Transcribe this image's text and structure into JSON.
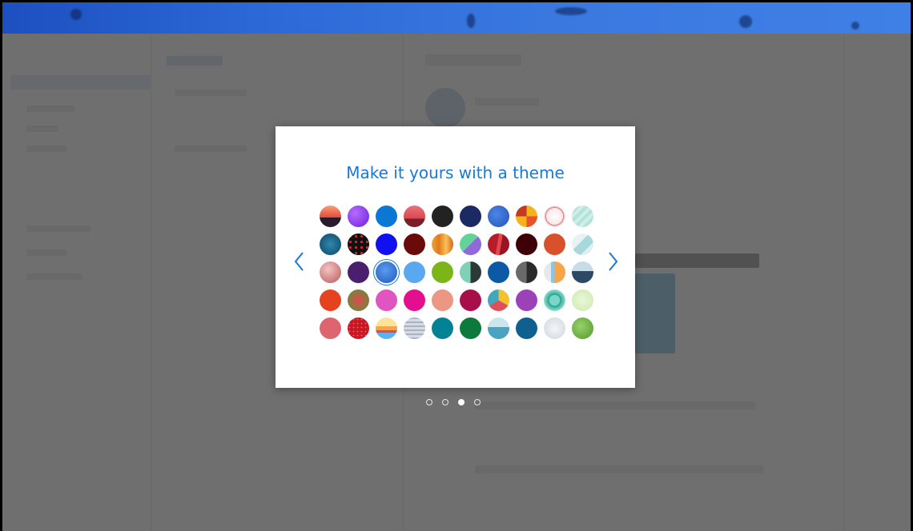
{
  "dialog": {
    "title": "Make it yours with a theme",
    "prev_icon": "chevron-left-icon",
    "next_icon": "chevron-right-icon"
  },
  "pager": {
    "count": 4,
    "active_index": 2
  },
  "colors": {
    "accent": "#1a78d6",
    "overlay": "rgba(80,80,80,0.82)",
    "header_band": "#2d6ad8"
  },
  "themes": [
    [
      {
        "name": "sunset",
        "bg": "linear-gradient(180deg,#f6a07a 0%,#e44b3a 55%,#2b1a2e 56%,#2b1a2e 100%)"
      },
      {
        "name": "purple-swirl",
        "bg": "radial-gradient(circle at 35% 35%,#b66cff,#6b1fe0)"
      },
      {
        "name": "blue",
        "bg": "#0a78d4"
      },
      {
        "name": "red-mountains",
        "bg": "linear-gradient(180deg,#e8737a 0%,#d9484f 60%,#7a1e2c 61%,#7a1e2c 100%)"
      },
      {
        "name": "charcoal",
        "bg": "#222222"
      },
      {
        "name": "navy",
        "bg": "#1c2a63"
      },
      {
        "name": "blue-texture",
        "bg": "radial-gradient(circle at 40% 40%,#4d86e6,#1f55b8)"
      },
      {
        "name": "orange-geo",
        "bg": "conic-gradient(#f5b21b 0 25%,#e8532a 0 50%,#f5b21b 0 75%,#c23a20 0)"
      },
      {
        "name": "cat-pattern",
        "bg": "radial-gradient(circle at 50% 50%,#fff 0,#fbe6e6 55%,#e57070 56%,#fff 70%)"
      },
      {
        "name": "mint-stripes",
        "bg": "repeating-linear-gradient(135deg,#cfeee8 0 4px,#b3e2da 4px 8px)"
      }
    ],
    [
      {
        "name": "circuit",
        "bg": "radial-gradient(circle at 50% 50%,#2c8ab0,#0f4460)"
      },
      {
        "name": "red-dots",
        "bg": "radial-gradient(circle,#e0202a 30%,#111 32%) 0 0/7px 7px"
      },
      {
        "name": "electric-blue",
        "bg": "#1010f0"
      },
      {
        "name": "maroon",
        "bg": "#6a0a0a"
      },
      {
        "name": "orange-drapes",
        "bg": "linear-gradient(90deg,#f4a23a,#e07a1a,#f6c15a,#d6651a)"
      },
      {
        "name": "green-purple",
        "bg": "linear-gradient(135deg,#62d39b 0 50%,#8f6ad8 50% 100%)"
      },
      {
        "name": "crimson-stripe",
        "bg": "linear-gradient(100deg,#b71c2a 0 45%,#e24850 45% 60%,#9a1422 60% 100%)"
      },
      {
        "name": "dark-maroon",
        "bg": "#3d0008"
      },
      {
        "name": "rust",
        "bg": "#d9512b"
      },
      {
        "name": "ice-geo",
        "bg": "linear-gradient(135deg,#e5f3f3 0 40%,#a8d8da 40% 70%,#e0f0f0 70% 100%)"
      }
    ],
    [
      {
        "name": "rose-sphere",
        "bg": "radial-gradient(circle at 40% 35%,#f6c3c3,#b95959)"
      },
      {
        "name": "deep-purple",
        "bg": "#4b1f6e"
      },
      {
        "name": "blue-wave",
        "bg": "radial-gradient(circle at 45% 40%,#5c9bee,#1b5bbf)"
      },
      {
        "name": "sky",
        "bg": "#5aa8f0"
      },
      {
        "name": "lime",
        "bg": "#7cb518"
      },
      {
        "name": "sage-split",
        "bg": "linear-gradient(90deg,#7fd0b5 0 50%,#2b3a38 50% 100%)"
      },
      {
        "name": "cobalt",
        "bg": "#0c5aa6"
      },
      {
        "name": "gray-split",
        "bg": "linear-gradient(90deg,#6a6a6a 0 50%,#2a2a2a 50% 100%)"
      },
      {
        "name": "peach-split",
        "bg": "linear-gradient(90deg,#e8e8e8 0 33%,#8ac6e8 33% 50%,#f7a54a 50% 100%)"
      },
      {
        "name": "mountain",
        "bg": "linear-gradient(180deg,#c7dbe9 0 45%,#2c4a66 45% 100%)"
      }
    ],
    [
      {
        "name": "vermilion",
        "bg": "#e5421f"
      },
      {
        "name": "rose-garden",
        "bg": "radial-gradient(circle at 50% 50%,#e34a4a,#4a9a3a)"
      },
      {
        "name": "orchid",
        "bg": "#e055c0"
      },
      {
        "name": "magenta",
        "bg": "#e40f8e"
      },
      {
        "name": "salmon",
        "bg": "#ec9784"
      },
      {
        "name": "raspberry",
        "bg": "#a80f4a"
      },
      {
        "name": "tri-color",
        "bg": "conic-gradient(#f2c231 0 33%,#e0505a 0 66%,#3ea8c0 0)"
      },
      {
        "name": "violet",
        "bg": "#9b42b8"
      },
      {
        "name": "robot",
        "bg": "radial-gradient(circle at 50% 50%,#7ad6c8 0 35%,#2aa08e 36%,#8de0d2 70%)"
      },
      {
        "name": "pale-green",
        "bg": "radial-gradient(circle,#e9f7d8,#cdeab1)"
      }
    ],
    [
      {
        "name": "coral-blush",
        "bg": "#de6470"
      },
      {
        "name": "red-dots-2",
        "bg": "radial-gradient(circle,#f2555d 28%,#c81824 30%) 0 0/5px 5px"
      },
      {
        "name": "rainbow-cloud",
        "bg": "linear-gradient(180deg,#fbe39a 0 40%,#f6a44b 40% 60%,#e44 60% 70%,#5ab3f0 70% 100%)"
      },
      {
        "name": "grid-gray",
        "bg": "repeating-linear-gradient(0deg,#a9b3c4 0 2px,#d6dbe4 2px 5px)"
      },
      {
        "name": "teal",
        "bg": "#038296"
      },
      {
        "name": "forest",
        "bg": "#0b7a3a"
      },
      {
        "name": "lake",
        "bg": "linear-gradient(180deg,#c9e6ef 0 45%,#4aa3c2 45% 100%)"
      },
      {
        "name": "ocean",
        "bg": "#0f5f8f"
      },
      {
        "name": "frost",
        "bg": "radial-gradient(circle,#f4f6f8,#cfd6dc)"
      },
      {
        "name": "leaf",
        "bg": "radial-gradient(circle at 40% 40%,#9ad06a,#4f9a2a)"
      }
    ]
  ],
  "selected": {
    "row": 2,
    "col": 2
  }
}
